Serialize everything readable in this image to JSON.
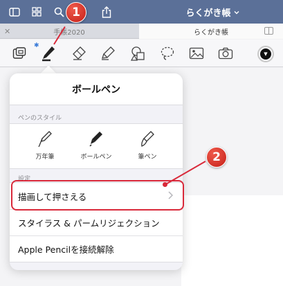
{
  "navbar": {
    "title": "らくがき帳",
    "icons": [
      "sidebar-icon",
      "grid-icon",
      "search-icon",
      "bookmark-icon",
      "share-icon",
      "chevron-down-icon"
    ]
  },
  "tabs": [
    {
      "label": "手帳2020",
      "active": false
    },
    {
      "label": "らくがき帳",
      "active": true
    }
  ],
  "toolbar": {
    "tools": [
      "reading-mode-icon",
      "pen-icon",
      "eraser-icon",
      "highlighter-icon",
      "shapes-icon",
      "lasso-icon",
      "image-icon",
      "camera-icon"
    ],
    "selected_tool": "pen-icon",
    "current_color": "#111111"
  },
  "popover": {
    "title": "ボールペン",
    "pen_style_label": "ペンのスタイル",
    "pen_styles": [
      {
        "label": "万年筆",
        "icon": "fountain-pen-icon"
      },
      {
        "label": "ボールペン",
        "icon": "ballpoint-pen-icon",
        "selected": true
      },
      {
        "label": "筆ペン",
        "icon": "brush-pen-icon"
      }
    ],
    "settings_label": "設定",
    "settings": [
      {
        "label": "描画して押さえる",
        "has_chevron": true
      },
      {
        "label": "スタイラス & パームリジェクション",
        "has_chevron": false
      },
      {
        "label": "Apple Pencilを接続解除",
        "has_chevron": false
      }
    ]
  },
  "annotations": {
    "badge_1": "1",
    "badge_2": "2",
    "accent_color": "#d9293a"
  }
}
